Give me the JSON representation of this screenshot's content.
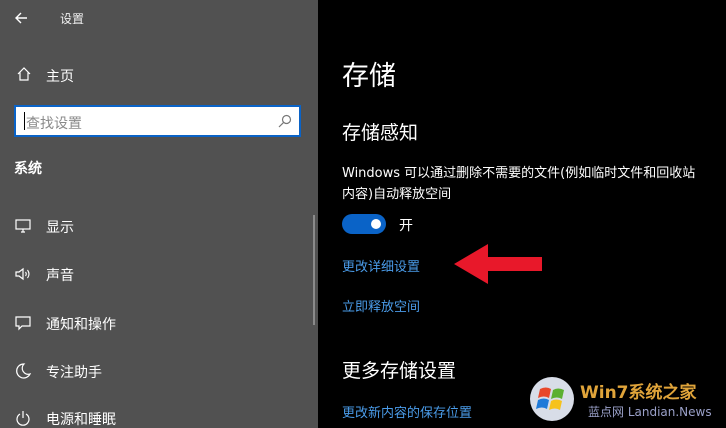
{
  "window": {
    "title": "设置"
  },
  "sidebar": {
    "home_label": "主页",
    "search_placeholder": "查找设置",
    "section_title": "系统",
    "items": [
      {
        "label": "显示",
        "icon": "monitor-icon"
      },
      {
        "label": "声音",
        "icon": "speaker-icon"
      },
      {
        "label": "通知和操作",
        "icon": "notification-icon"
      },
      {
        "label": "专注助手",
        "icon": "moon-icon"
      },
      {
        "label": "电源和睡眠",
        "icon": "power-icon"
      }
    ]
  },
  "main": {
    "page_title": "存储",
    "storage_sense_title": "存储感知",
    "description_line1": "Windows 可以通过删除不需要的文件(例如临时文件和回收站",
    "description_line2": "内容)自动释放空间",
    "toggle_label": "开",
    "toggle_on": true,
    "link_change_details": "更改详细设置",
    "link_free_now": "立即释放空间",
    "more_settings_title": "更多存储设置",
    "link_change_save_location": "更改新内容的保存位置"
  },
  "annotation": {
    "arrow_color": "#e8182a",
    "arrow_icon": "red-arrow-icon"
  },
  "watermark": {
    "site": "Win7系统之家",
    "sub": "蓝点网 Landian.News"
  },
  "colors": {
    "sidebar_bg": "#515151",
    "main_bg": "#000000",
    "accent": "#0a63c7",
    "link": "#4a9be8"
  }
}
